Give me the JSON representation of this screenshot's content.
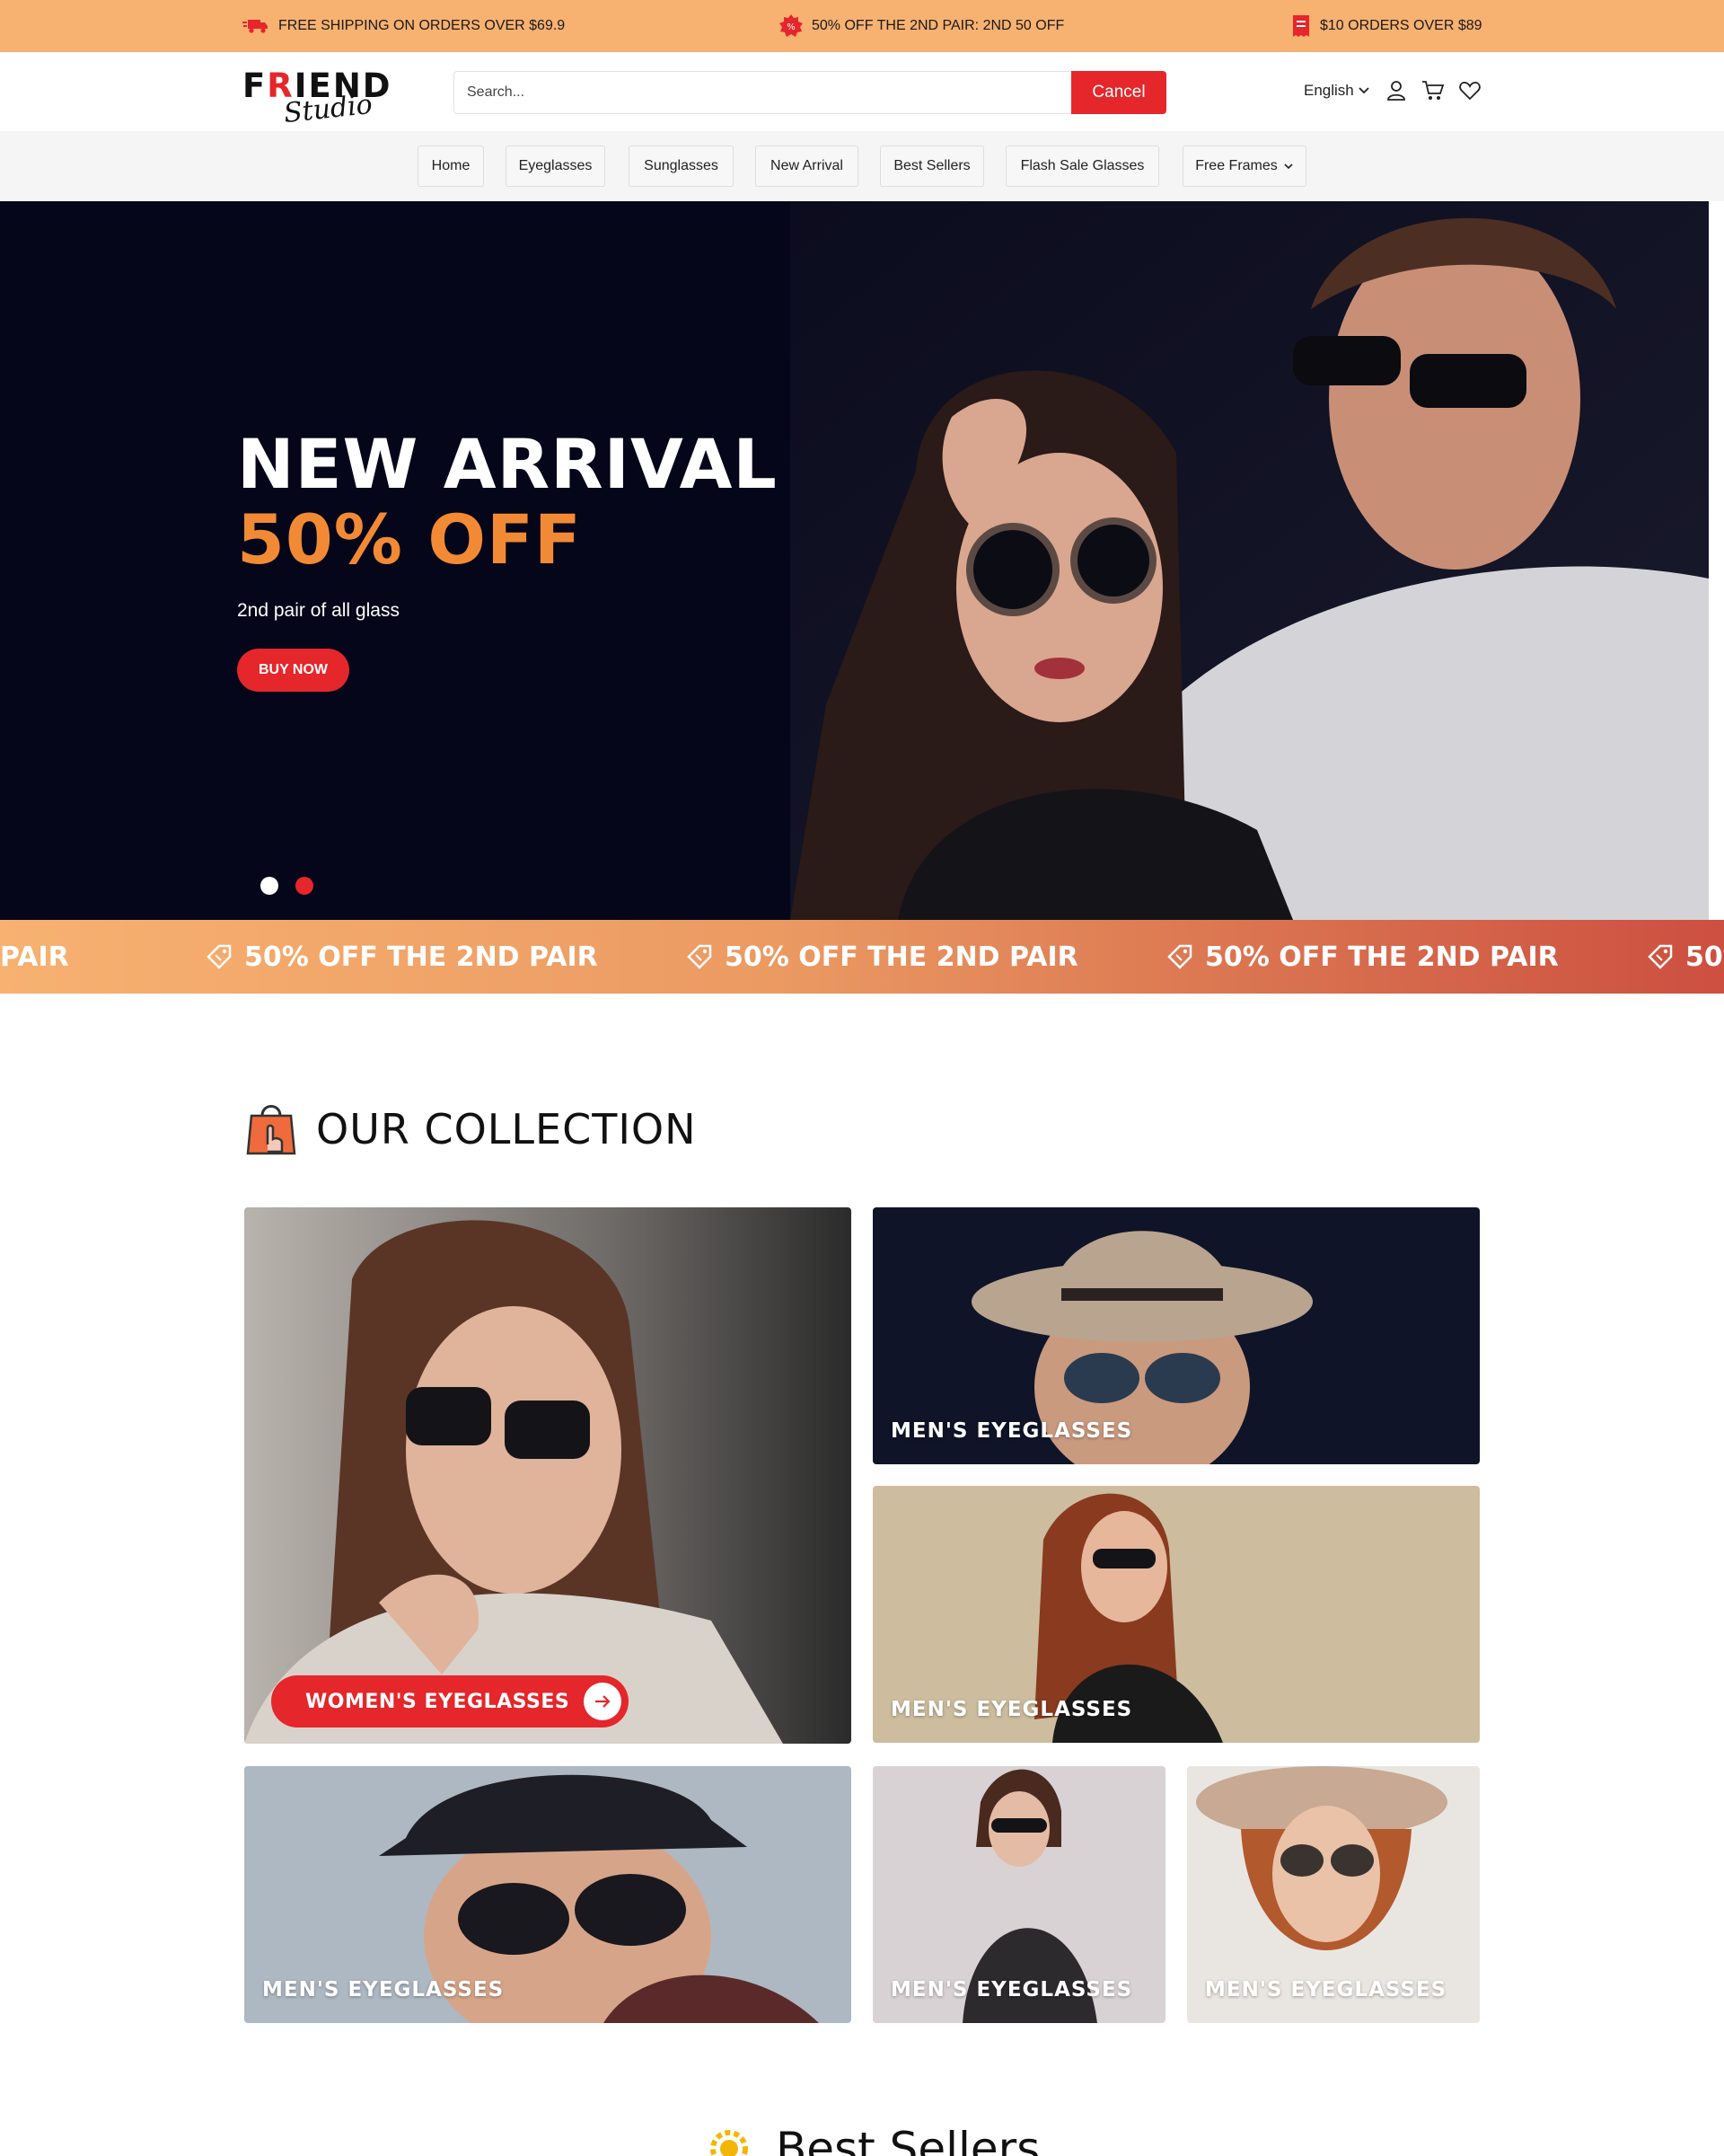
{
  "promo_bar": {
    "items": [
      {
        "icon": "truck-icon",
        "text": "FREE SHIPPING ON ORDERS OVER $69.9"
      },
      {
        "icon": "percent-badge-icon",
        "text": "50% OFF THE 2ND PAIR: 2ND 50 OFF"
      },
      {
        "icon": "receipt-icon",
        "text": "$10 ORDERS OVER $89"
      }
    ],
    "background": "#f7b171"
  },
  "header": {
    "logo": {
      "word1_a": "F",
      "word1_red": "R",
      "word1_b": "IEND",
      "word2": "Studio"
    },
    "search": {
      "placeholder": "Search...",
      "value": ""
    },
    "cancel_label": "Cancel",
    "language": "English",
    "icons": [
      "user-icon",
      "cart-icon",
      "heart-icon"
    ]
  },
  "nav": {
    "items": [
      {
        "label": "Home"
      },
      {
        "label": "Eyeglasses"
      },
      {
        "label": "Sunglasses"
      },
      {
        "label": "New Arrival"
      },
      {
        "label": "Best Sellers"
      },
      {
        "label": "Flash Sale Glasses"
      },
      {
        "label": "Free Frames",
        "dropdown": true
      }
    ]
  },
  "hero": {
    "title": "NEW ARRIVAL",
    "offer": "50% OFF",
    "subtitle": "2nd pair of all glass",
    "button": "BUY NOW",
    "slides": 2,
    "active_slide": 2
  },
  "marquee": {
    "text": "50% OFF THE 2ND PAIR",
    "partial_left": "PAIR",
    "partial_right": "50%",
    "icon": "discount-tag-icon"
  },
  "collection": {
    "title": "OUR COLLECTION",
    "cards": [
      {
        "label": "WOMEN'S EYEGLASSES",
        "featured": true
      },
      {
        "label": "MEN'S EYEGLASSES"
      },
      {
        "label": "MEN'S EYEGLASSES"
      },
      {
        "label": "MEN'S EYEGLASSES"
      },
      {
        "label": "MEN'S EYEGLASSES"
      },
      {
        "label": "MEN'S EYEGLASSES"
      }
    ]
  },
  "best_sellers": {
    "title": "Best Sellers"
  },
  "colors": {
    "accent_red": "#e5262a",
    "accent_orange": "#f28a35",
    "hero_bg": "#05061a"
  }
}
